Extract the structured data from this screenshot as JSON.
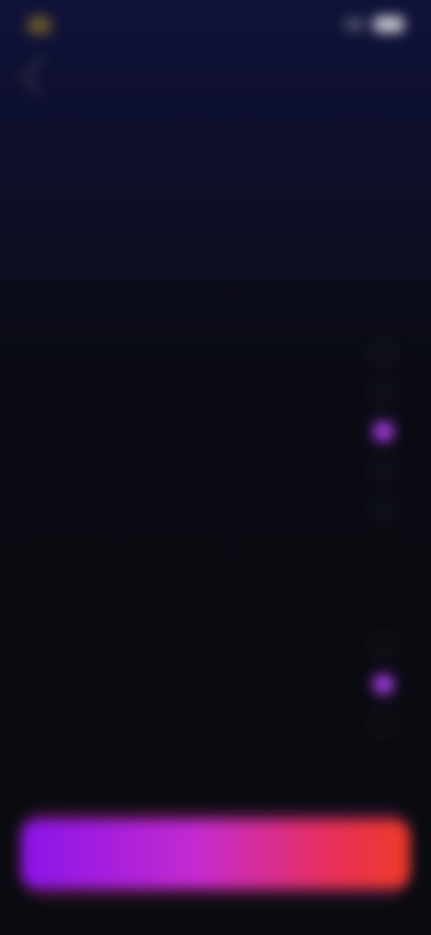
{
  "status_bar": {
    "carrier": "",
    "signal_icon": "signal-icon",
    "battery_icon": "battery-icon"
  },
  "header": {
    "back_icon": "back-arrow-icon",
    "brand": "",
    "tag": "",
    "title": "",
    "subtitle": ""
  },
  "sections": [
    {
      "title": "",
      "options": [
        {
          "label": "",
          "selected": false
        },
        {
          "label": "",
          "selected": false
        },
        {
          "label": "",
          "selected": true
        },
        {
          "label": "",
          "selected": false
        },
        {
          "label": "",
          "selected": false
        }
      ]
    },
    {
      "title": "",
      "options": [
        {
          "label": "",
          "selected": false
        },
        {
          "label": "",
          "selected": true
        },
        {
          "label": "",
          "selected": false
        }
      ]
    }
  ],
  "cta": {
    "label": ""
  },
  "colors": {
    "accent_purple": "#8a14e8",
    "accent_red": "#ef3a26",
    "background": "#0a0b12"
  }
}
